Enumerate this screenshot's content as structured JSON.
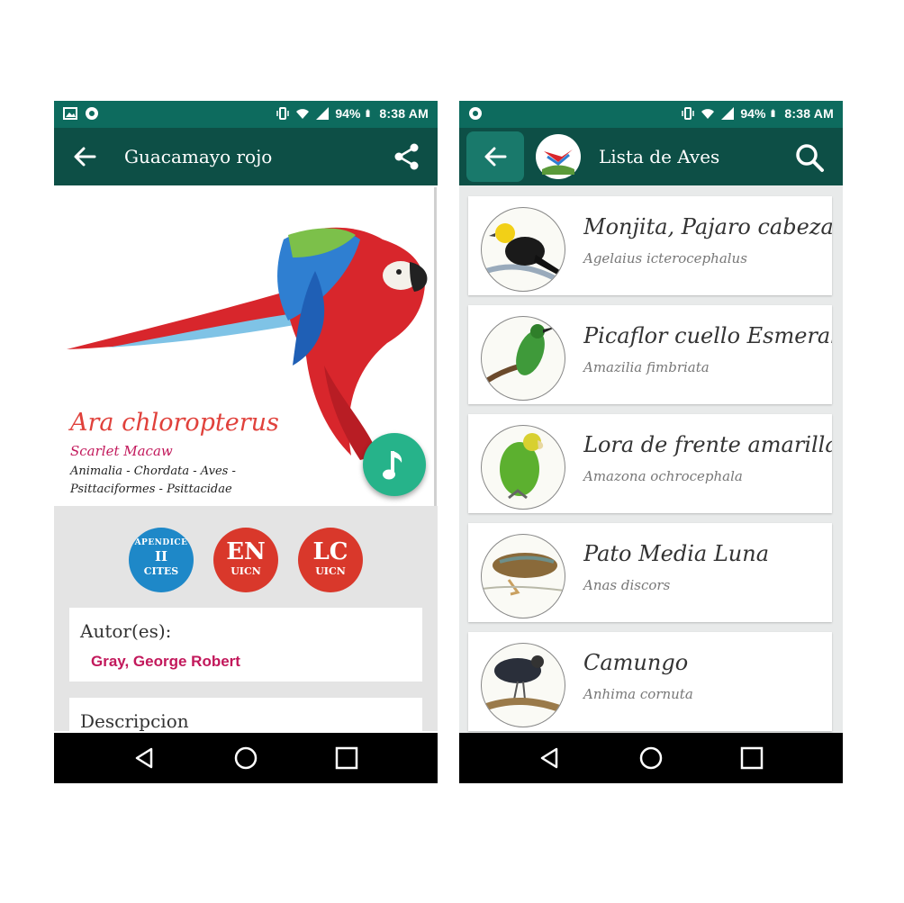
{
  "status_bar": {
    "battery": "94%",
    "time": "8:38 AM"
  },
  "detail_screen": {
    "title": "Guacamayo rojo",
    "scientific_name": "Ara chloropterus",
    "common_name": "Scarlet Macaw",
    "taxonomy": "Animalia - Chordata - Aves - Psittaciformes - Psittacidae",
    "badges": [
      {
        "line1": "APENDICE",
        "line2": "II",
        "line3": "CITES",
        "color": "#1e88c8"
      },
      {
        "line1": "EN",
        "line2": "UICN",
        "color": "#d9382b"
      },
      {
        "line1": "LC",
        "line2": "UICN",
        "color": "#d9382b"
      }
    ],
    "author_label": "Autor(es):",
    "author_value": "Gray, George Robert",
    "description_label": "Descripcion"
  },
  "list_screen": {
    "title": "Lista de Aves",
    "birds": [
      {
        "name": "Monjita, Pajaro cabeza amarilla",
        "scientific": "Agelaius icterocephalus",
        "icon": "yellow-headed-blackbird"
      },
      {
        "name": "Picaflor cuello Esmeralda",
        "scientific": "Amazilia fimbriata",
        "icon": "hummingbird"
      },
      {
        "name": "Lora de frente amarilla",
        "scientific": "Amazona ochrocephala",
        "icon": "parrot"
      },
      {
        "name": "Pato Media Luna",
        "scientific": "Anas discors",
        "icon": "duck"
      },
      {
        "name": "Camungo",
        "scientific": "Anhima cornuta",
        "icon": "screamer"
      }
    ]
  },
  "colors": {
    "statusbar": "#0d6b5e",
    "appbar": "#0d4f46",
    "accent_red": "#e0413b",
    "fab": "#26b38a"
  }
}
